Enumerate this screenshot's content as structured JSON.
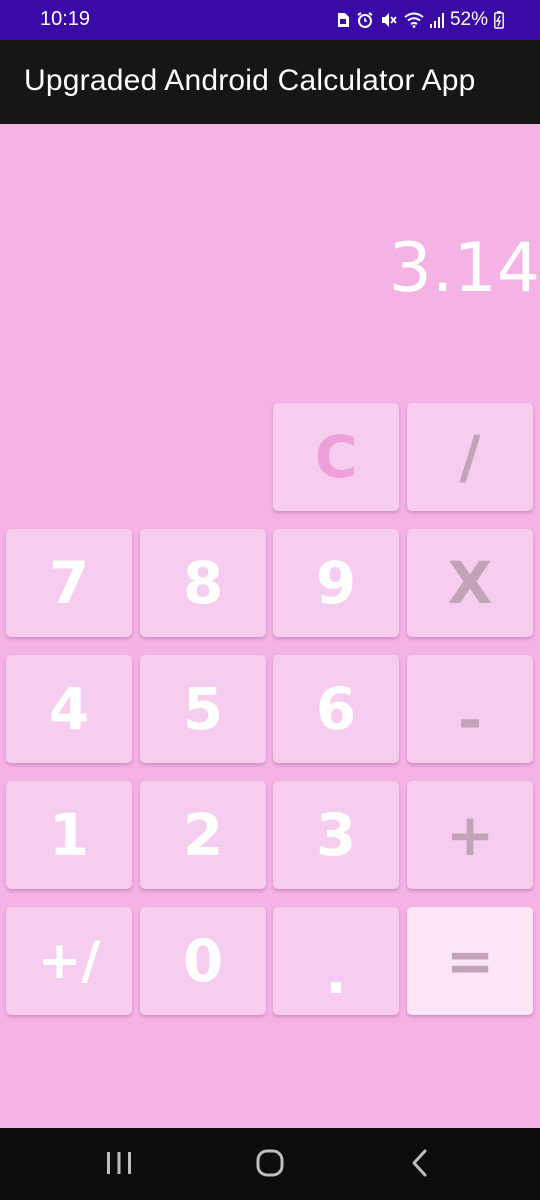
{
  "status_bar": {
    "time": "10:19",
    "battery": "52%",
    "icons": [
      "sim-icon",
      "alarm-icon",
      "mute-icon",
      "wifi-icon",
      "signal-icon",
      "battery-icon"
    ]
  },
  "app_bar": {
    "title": "Upgraded Android Calculator App"
  },
  "display": {
    "value": "3.14"
  },
  "keypad": {
    "clear": "C",
    "divide": "/",
    "seven": "7",
    "eight": "8",
    "nine": "9",
    "multiply": "X",
    "four": "4",
    "five": "5",
    "six": "6",
    "subtract": "-",
    "one": "1",
    "two": "2",
    "three": "3",
    "add": "+",
    "sign": "+/",
    "zero": "0",
    "decimal": ".",
    "equals": "="
  },
  "nav_bar": {
    "buttons": [
      "recents-icon",
      "home-icon",
      "back-icon"
    ]
  },
  "colors": {
    "status_bar": "#3a0aa6",
    "app_bar": "#161616",
    "background": "#f4b3e4",
    "key": "#f6cdee",
    "equals_key": "#fce6f6",
    "digit_text": "#ffffff",
    "operator_text": "#c2a3b9",
    "clear_text": "#eda0d9"
  }
}
